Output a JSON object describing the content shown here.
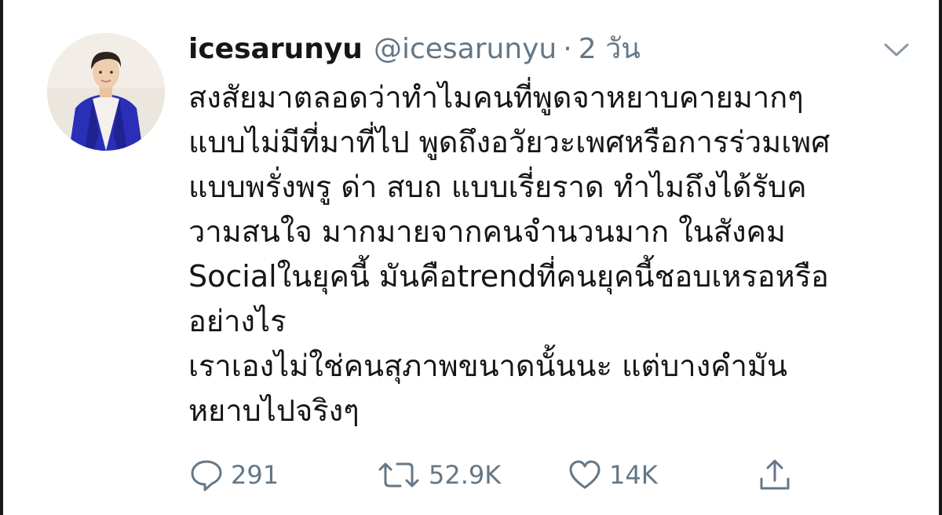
{
  "tweet": {
    "display_name": "icesarunyu",
    "handle": "@icesarunyu",
    "separator": "·",
    "time": "2 วัน",
    "text_lines": [
      "สงสัยมาตลอดว่าทำไมคนที่พูดจาหยาบคายมากๆ",
      "แบบไม่มีที่มาที่ไป พูดถึงอวัยวะเพศหรือการร่วมเพศ",
      "แบบพรั่งพรู ด่า สบถ แบบเรี่ยราด ทำไมถึงได้รับค",
      "วามสนใจ มากมายจากคนจำนวนมาก ในสังคม",
      "Socialในยุคนี้ มันคือtrendที่คนยุคนี้ชอบเหรอหรือ",
      "อย่างไร",
      "เราเองไม่ใช่คนสุภาพขนาดนั้นนะ แต่บางคำมัน",
      "หยาบไปจริงๆ"
    ],
    "actions": {
      "reply_count": "291",
      "retweet_count": "52.9K",
      "like_count": "14K"
    },
    "icons": {
      "reply": "reply-icon",
      "retweet": "retweet-icon",
      "like": "heart-icon",
      "share": "share-icon",
      "menu": "chevron-down-icon"
    },
    "colors": {
      "text": "#14171a",
      "secondary": "#657786",
      "avatar_jacket": "#2a2fb8"
    }
  }
}
